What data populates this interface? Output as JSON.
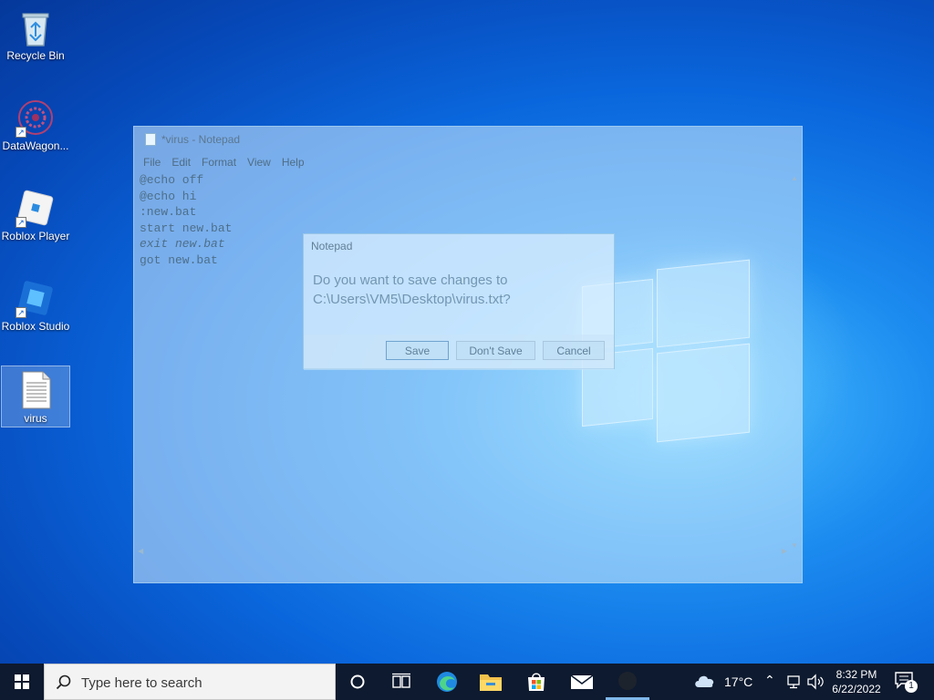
{
  "desktop": {
    "icons": [
      {
        "label": "Recycle Bin",
        "icon": "recycle-bin-icon"
      },
      {
        "label": "DataWagon...",
        "icon": "datawagon-icon"
      },
      {
        "label": "Roblox Player",
        "icon": "roblox-player-icon"
      },
      {
        "label": "Roblox Studio",
        "icon": "roblox-studio-icon"
      },
      {
        "label": "virus",
        "icon": "text-file-icon",
        "selected": true
      }
    ]
  },
  "notepad": {
    "title": "*virus - Notepad",
    "menu": [
      "File",
      "Edit",
      "Format",
      "View",
      "Help"
    ],
    "lines": [
      "@echo off",
      "@echo hi",
      ":new.bat",
      "start new.bat",
      "exit new.bat",
      "got new.bat"
    ]
  },
  "dialog": {
    "title": "Notepad",
    "message_line1": "Do you want to save changes to",
    "message_line2": "C:\\Users\\VM5\\Desktop\\virus.txt?",
    "buttons": {
      "save": "Save",
      "dont_save": "Don't Save",
      "cancel": "Cancel"
    }
  },
  "taskbar": {
    "search_placeholder": "Type here to search",
    "apps": [
      "task-view-icon",
      "edge-icon",
      "file-explorer-icon",
      "store-icon",
      "mail-icon",
      "app-icon"
    ],
    "weather": {
      "temp": "17°C",
      "icon": "cloud-icon"
    },
    "clock": {
      "time": "8:32 PM",
      "date": "6/22/2022"
    },
    "notification_count": "1",
    "colors": {
      "taskbar": "#0e1a2f",
      "accent": "#0a66dc"
    }
  }
}
